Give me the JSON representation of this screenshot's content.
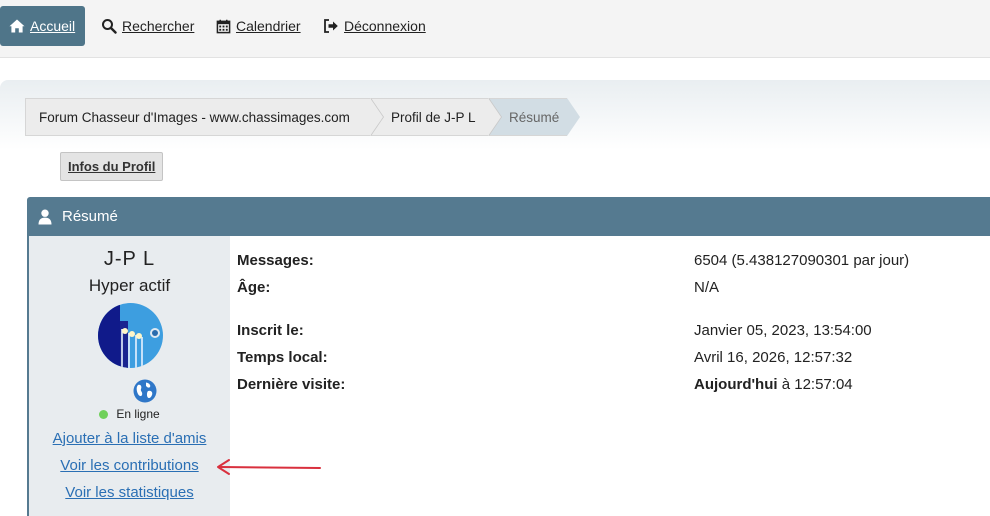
{
  "nav": {
    "home": "Accueil",
    "search": "Rechercher",
    "calendar": "Calendrier",
    "logout": "Déconnexion"
  },
  "breadcrumb": {
    "forum": "Forum Chasseur d'Images - www.chassimages.com",
    "profile": "Profil de J-P L",
    "current": "Résumé"
  },
  "profile_button": "Infos du Profil",
  "panel": {
    "title": "Résumé",
    "username": "J-P L",
    "rank": "Hyper actif",
    "status": "En ligne",
    "links": {
      "add_friend": "Ajouter à la liste d'amis",
      "contributions": "Voir les contributions",
      "stats": "Voir les statistiques"
    },
    "rows": [
      {
        "label": "Messages:",
        "value": "6504 (5.438127090301 par jour)"
      },
      {
        "label": "Âge:",
        "value": "N/A"
      },
      {
        "label": "Inscrit le:",
        "value": "Janvier 05, 2023, 13:54:00"
      },
      {
        "label": "Temps local:",
        "value": "Avril 16, 2026, 12:57:32"
      },
      {
        "label": "Dernière visite:",
        "value_bold": "Aujourd'hui",
        "value_rest": " à 12:57:04"
      }
    ]
  },
  "colors": {
    "accent": "#557a90",
    "link": "#2a6fb4",
    "online": "#6fd05a",
    "annotation_arrow": "#d9303e"
  },
  "icons": [
    "home-icon",
    "search-icon",
    "calendar-icon",
    "logout-icon",
    "user-icon",
    "globe-icon"
  ]
}
